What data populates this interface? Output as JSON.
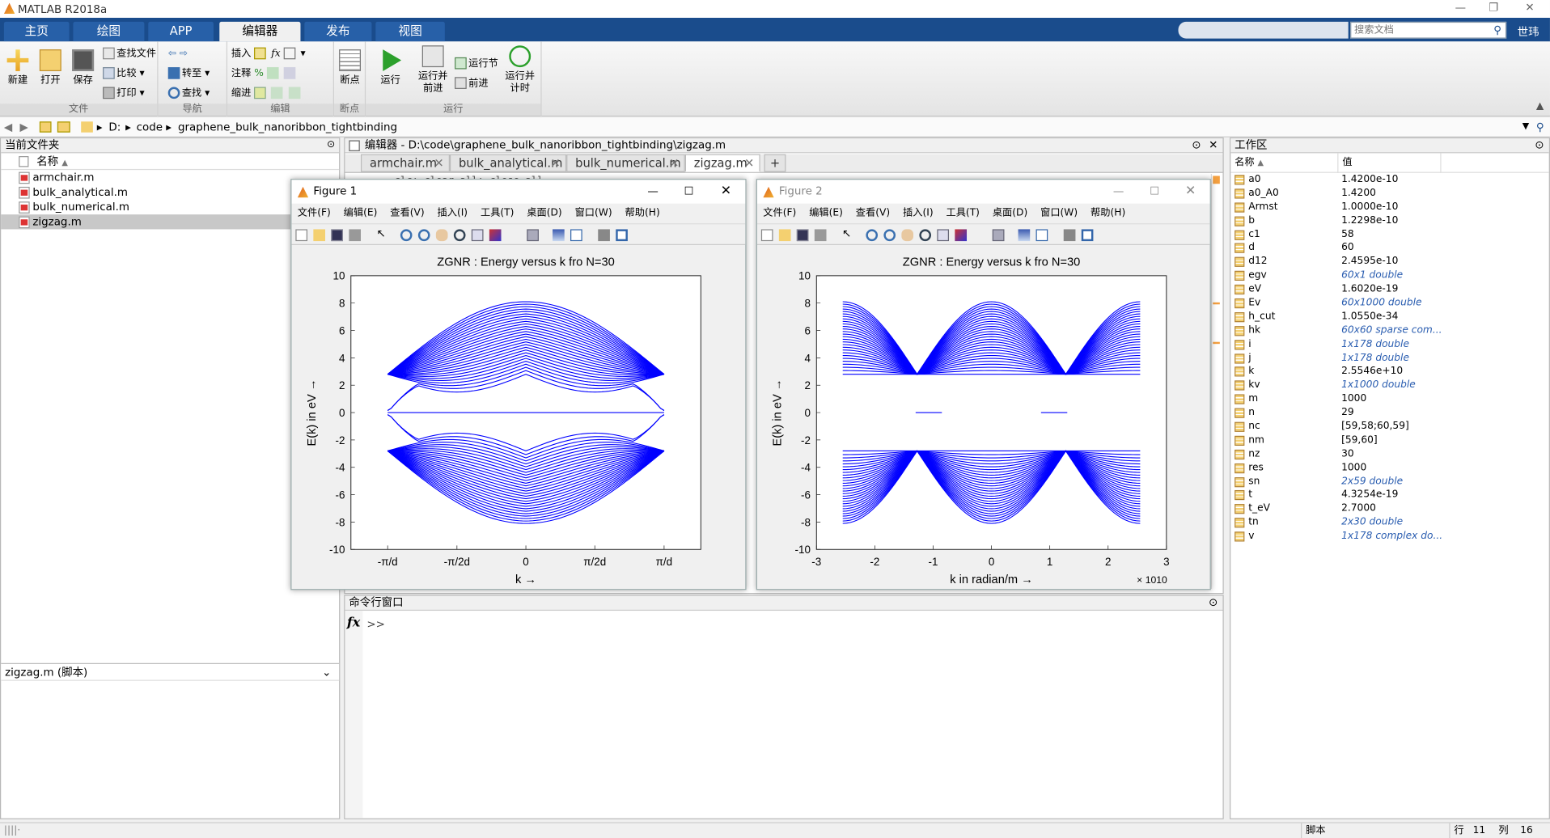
{
  "app": {
    "title": "MATLAB R2018a",
    "user": "世玮"
  },
  "tabs": [
    "主页",
    "绘图",
    "APP",
    "编辑器",
    "发布",
    "视图"
  ],
  "search": {
    "placeholder": "搜索文档"
  },
  "ribbon": {
    "file": {
      "label": "文件",
      "new": "新建",
      "open": "打开",
      "save": "保存",
      "find_files": "查找文件",
      "compare": "比较",
      "print": "打印"
    },
    "nav": {
      "label": "导航",
      "goto": "转至",
      "find": "查找"
    },
    "edit": {
      "label": "编辑",
      "insert": "插入",
      "comment": "注释",
      "indent": "缩进"
    },
    "breakpoints": {
      "label": "断点",
      "breakpoints": "断点"
    },
    "run": {
      "label": "运行",
      "run": "运行",
      "run_advance": "运行并\n前进",
      "run_section": "运行节",
      "advance": "前进",
      "run_time": "运行并\n计时"
    }
  },
  "address": {
    "path": [
      "D:",
      "code",
      "graphene_bulk_nanoribbon_tightbinding"
    ]
  },
  "current_folder": {
    "title": "当前文件夹",
    "col_name": "名称",
    "files": [
      "armchair.m",
      "bulk_analytical.m",
      "bulk_numerical.m",
      "zigzag.m"
    ],
    "details": "zigzag.m  (脚本)"
  },
  "editor": {
    "title": "编辑器 - D:\\code\\graphene_bulk_nanoribbon_tightbinding\\zigzag.m",
    "tabs": [
      "armchair.m",
      "bulk_analytical.m",
      "bulk_numerical.m",
      "zigzag.m"
    ],
    "code_peek": "clc; clear all; close all"
  },
  "command_window": {
    "title": "命令行窗口",
    "prompt": ">>"
  },
  "figures": [
    {
      "title": "Figure 1",
      "menus": [
        "文件(F)",
        "编辑(E)",
        "查看(V)",
        "插入(I)",
        "工具(T)",
        "桌面(D)",
        "窗口(W)",
        "帮助(H)"
      ]
    },
    {
      "title": "Figure 2",
      "menus": [
        "文件(F)",
        "编辑(E)",
        "查看(V)",
        "插入(I)",
        "工具(T)",
        "桌面(D)",
        "窗口(W)",
        "帮助(H)"
      ]
    }
  ],
  "chart_data": [
    {
      "type": "line",
      "title": "ZGNR : Energy versus k_y fro N_z=30",
      "xlabel": "k_y →",
      "ylabel": "E(k_y) in eV →",
      "ylim": [
        -10,
        10
      ],
      "xtick_labels": [
        "-π/d",
        "-π/2d",
        "0",
        "π/2d",
        "π/d"
      ],
      "ytick_labels": [
        "10",
        "8",
        "6",
        "4",
        "2",
        "0",
        "-2",
        "-4",
        "-6",
        "-8",
        "-10"
      ],
      "color": "#0000ff",
      "bands": 60,
      "grid": false,
      "series": [
        {
          "x": [
            -3.14,
            -1.57,
            0,
            1.57,
            3.14
          ],
          "upper_band_max": [
            2.8,
            6.0,
            8.1,
            6.0,
            2.8
          ],
          "upper_band_min": [
            2.8,
            1.5,
            2.8,
            1.5,
            2.8
          ],
          "edge_state": [
            0,
            0,
            0.3,
            0,
            0
          ]
        }
      ]
    },
    {
      "type": "line",
      "title": "ZGNR : Energy versus k_y fro N_z=30",
      "xlabel": "k_y in radian/m →",
      "ylabel": "E(k_y) in eV →",
      "ylim": [
        -10,
        10
      ],
      "xlim": [
        -3,
        3
      ],
      "x_multiplier": "× 10^10",
      "xtick_labels": [
        "-3",
        "-2",
        "-1",
        "0",
        "1",
        "2",
        "3"
      ],
      "ytick_labels": [
        "10",
        "8",
        "6",
        "4",
        "2",
        "0",
        "-2",
        "-4",
        "-6",
        "-8",
        "-10"
      ],
      "color": "#0000ff",
      "bands": 60,
      "grid": false,
      "series": [
        {
          "x": [
            -2.55,
            -1.28,
            0,
            1.28,
            2.55
          ],
          "upper_band_max": [
            8.1,
            2.8,
            8.1,
            2.8,
            8.1
          ],
          "edge_state_range": [
            -1.28,
            -0.85,
            0.85,
            1.28
          ]
        }
      ]
    }
  ],
  "workspace": {
    "title": "工作区",
    "col_name": "名称",
    "col_value": "值",
    "vars": [
      {
        "n": "a0",
        "v": "1.4200e-10",
        "it": false
      },
      {
        "n": "a0_A0",
        "v": "1.4200",
        "it": false
      },
      {
        "n": "Armst",
        "v": "1.0000e-10",
        "it": false
      },
      {
        "n": "b",
        "v": "1.2298e-10",
        "it": false
      },
      {
        "n": "c1",
        "v": "58",
        "it": false
      },
      {
        "n": "d",
        "v": "60",
        "it": false
      },
      {
        "n": "d12",
        "v": "2.4595e-10",
        "it": false
      },
      {
        "n": "egv",
        "v": "60x1 double",
        "it": true
      },
      {
        "n": "eV",
        "v": "1.6020e-19",
        "it": false
      },
      {
        "n": "Ev",
        "v": "60x1000 double",
        "it": true
      },
      {
        "n": "h_cut",
        "v": "1.0550e-34",
        "it": false
      },
      {
        "n": "hk",
        "v": "60x60 sparse com...",
        "it": true
      },
      {
        "n": "i",
        "v": "1x178 double",
        "it": true
      },
      {
        "n": "j",
        "v": "1x178 double",
        "it": true
      },
      {
        "n": "k",
        "v": "2.5546e+10",
        "it": false
      },
      {
        "n": "kv",
        "v": "1x1000 double",
        "it": true
      },
      {
        "n": "m",
        "v": "1000",
        "it": false
      },
      {
        "n": "n",
        "v": "29",
        "it": false
      },
      {
        "n": "nc",
        "v": "[59,58;60,59]",
        "it": false
      },
      {
        "n": "nm",
        "v": "[59,60]",
        "it": false
      },
      {
        "n": "nz",
        "v": "30",
        "it": false
      },
      {
        "n": "res",
        "v": "1000",
        "it": false
      },
      {
        "n": "sn",
        "v": "2x59 double",
        "it": true
      },
      {
        "n": "t",
        "v": "4.3254e-19",
        "it": false
      },
      {
        "n": "t_eV",
        "v": "2.7000",
        "it": false
      },
      {
        "n": "tn",
        "v": "2x30 double",
        "it": true
      },
      {
        "n": "v",
        "v": "1x178 complex do...",
        "it": true
      }
    ]
  },
  "status": {
    "mode": "脚本",
    "row_label": "行",
    "row": "11",
    "col_label": "列",
    "col": "16"
  }
}
